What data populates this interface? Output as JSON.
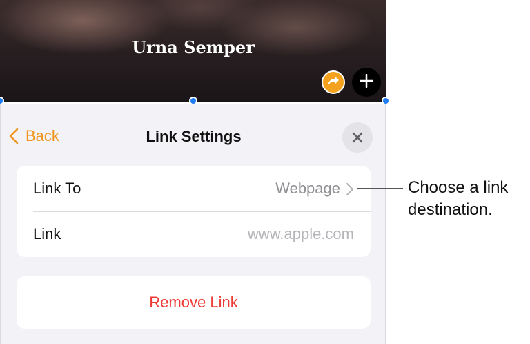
{
  "hero": {
    "title": "Urna Semper",
    "share_icon": "share-arrow-icon",
    "add_icon": "plus-icon",
    "share_color": "#f4a21d"
  },
  "nav": {
    "back_label": "Back",
    "title": "Link Settings",
    "close_icon": "close-icon",
    "accent_color": "#f09419"
  },
  "rows": {
    "link_to": {
      "label": "Link To",
      "value": "Webpage"
    },
    "link": {
      "label": "Link",
      "placeholder": "www.apple.com"
    }
  },
  "remove": {
    "label": "Remove Link",
    "color": "#ef3b36"
  },
  "callout": {
    "line1": "Choose a link",
    "line2": "destination."
  }
}
